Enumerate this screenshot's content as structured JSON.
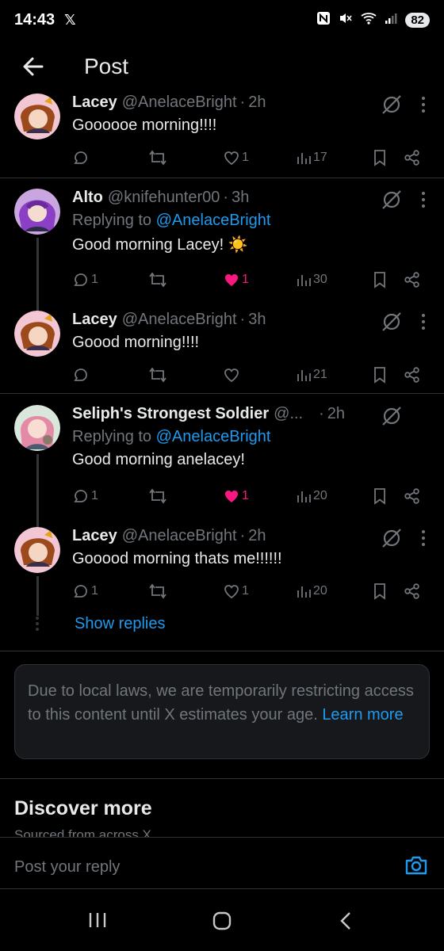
{
  "status": {
    "time": "14:43",
    "x_glyph": "𝕏",
    "battery": "82"
  },
  "header": {
    "title": "Post"
  },
  "posts": [
    {
      "name": "Lacey",
      "handle": "@AnelaceBright",
      "time": "2h",
      "reply_to_prefix": "",
      "reply_to": "",
      "text": "Goooooe morning!!!!",
      "replies": "",
      "reposts": "",
      "likes": "1",
      "views": "17",
      "liked": false
    },
    {
      "name": "Alto",
      "handle": "@knifehunter00",
      "time": "3h",
      "reply_to_prefix": "Replying to ",
      "reply_to": "@AnelaceBright",
      "text": "Good morning Lacey! ☀️",
      "replies": "1",
      "reposts": "",
      "likes": "1",
      "views": "30",
      "liked": true
    },
    {
      "name": "Lacey",
      "handle": "@AnelaceBright",
      "time": "3h",
      "reply_to_prefix": "",
      "reply_to": "",
      "text": "Goood morning!!!!",
      "replies": "",
      "reposts": "",
      "likes": "",
      "views": "21",
      "liked": false
    },
    {
      "name": "Seliph's Strongest Soldier",
      "handle": "@...",
      "time": "2h",
      "reply_to_prefix": "Replying to ",
      "reply_to": "@AnelaceBright",
      "text": "Good morning anelacey!",
      "replies": "1",
      "reposts": "",
      "likes": "1",
      "views": "20",
      "liked": true
    },
    {
      "name": "Lacey",
      "handle": "@AnelaceBright",
      "time": "2h",
      "reply_to_prefix": "",
      "reply_to": "",
      "text": "Gooood morning thats me!!!!!!",
      "replies": "1",
      "reposts": "",
      "likes": "1",
      "views": "20",
      "liked": false
    }
  ],
  "show_replies": "Show replies",
  "notice": {
    "text": "Due to local laws, we are temporarily restricting access to this content until X estimates your age. ",
    "link": "Learn more"
  },
  "discover": {
    "title": "Discover more",
    "subtitle": "Sourced from across X"
  },
  "reply_bar": {
    "placeholder": "Post your reply"
  },
  "colors": {
    "accent": "#1d9bf0",
    "like": "#f91880",
    "muted": "#71767b",
    "background": "#000000"
  }
}
